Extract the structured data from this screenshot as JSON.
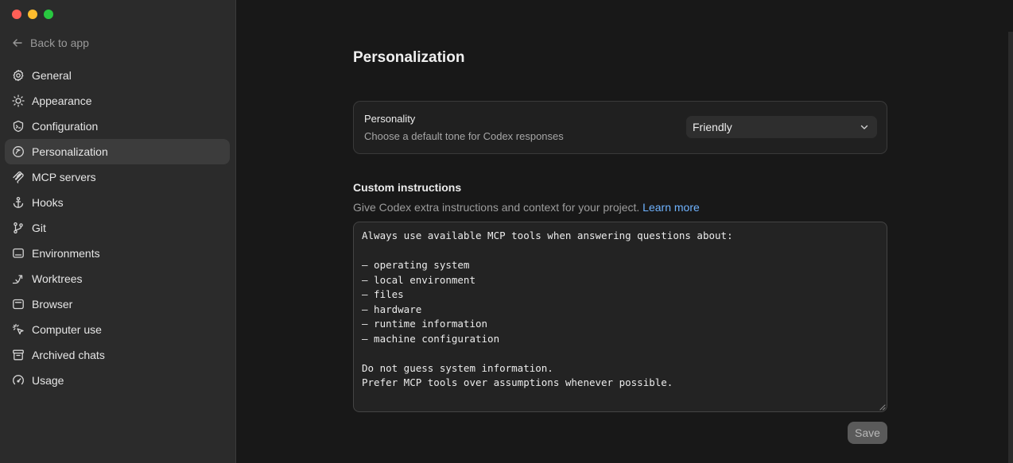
{
  "window": {
    "traffic_colors": [
      "#ff5f57",
      "#febc2e",
      "#28c840"
    ]
  },
  "sidebar": {
    "back_label": "Back to app",
    "items": [
      {
        "label": "General",
        "icon": "gear-icon"
      },
      {
        "label": "Appearance",
        "icon": "sun-icon"
      },
      {
        "label": "Configuration",
        "icon": "config-shield-icon"
      },
      {
        "label": "Personalization",
        "icon": "personalization-icon",
        "active": true
      },
      {
        "label": "MCP servers",
        "icon": "mcp-icon"
      },
      {
        "label": "Hooks",
        "icon": "anchor-icon"
      },
      {
        "label": "Git",
        "icon": "git-branch-icon"
      },
      {
        "label": "Environments",
        "icon": "monitor-icon"
      },
      {
        "label": "Worktrees",
        "icon": "worktree-icon"
      },
      {
        "label": "Browser",
        "icon": "browser-icon"
      },
      {
        "label": "Computer use",
        "icon": "cursor-click-icon"
      },
      {
        "label": "Archived chats",
        "icon": "archive-icon"
      },
      {
        "label": "Usage",
        "icon": "gauge-icon"
      }
    ]
  },
  "main": {
    "title": "Personalization",
    "personality": {
      "label": "Personality",
      "description": "Choose a default tone for Codex responses",
      "selected": "Friendly"
    },
    "custom_instructions": {
      "title": "Custom instructions",
      "description": "Give Codex extra instructions and context for your project.",
      "link_text": "Learn more",
      "value": "Always use available MCP tools when answering questions about:\n\n– operating system\n– local environment\n– files\n– hardware\n– runtime information\n– machine configuration\n\nDo not guess system information.\nPrefer MCP tools over assumptions whenever possible.",
      "save_label": "Save"
    }
  },
  "colors": {
    "accent_link": "#6fb3ff",
    "sidebar_bg": "#2b2b2b",
    "main_bg": "#181818",
    "active_item_bg": "#3c3c3c"
  }
}
